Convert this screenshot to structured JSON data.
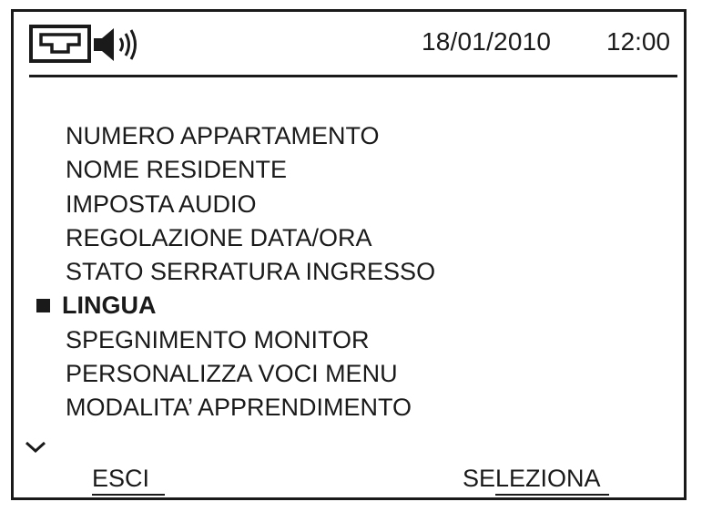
{
  "status_bar": {
    "icons": [
      "network-icon",
      "speaker-icon"
    ],
    "date": "18/01/2010",
    "time": "12:00"
  },
  "menu": {
    "items": [
      {
        "label": "NUMERO APPARTAMENTO",
        "selected": false
      },
      {
        "label": "NOME RESIDENTE",
        "selected": false
      },
      {
        "label": "IMPOSTA AUDIO",
        "selected": false
      },
      {
        "label": "REGOLAZIONE DATA/ORA",
        "selected": false
      },
      {
        "label": "STATO SERRATURA INGRESSO",
        "selected": false
      },
      {
        "label": "LINGUA",
        "selected": true
      },
      {
        "label": "SPEGNIMENTO MONITOR",
        "selected": false
      },
      {
        "label": "PERSONALIZZA VOCI MENU",
        "selected": false
      },
      {
        "label": "MODALITA’ APPRENDIMENTO",
        "selected": false
      }
    ],
    "scroll_indicator": "chevron-down-icon"
  },
  "softkeys": {
    "left_label": "ESCI",
    "right_label": "SELEZIONA"
  },
  "colors": {
    "foreground": "#1a1a1a",
    "background": "#ffffff"
  }
}
